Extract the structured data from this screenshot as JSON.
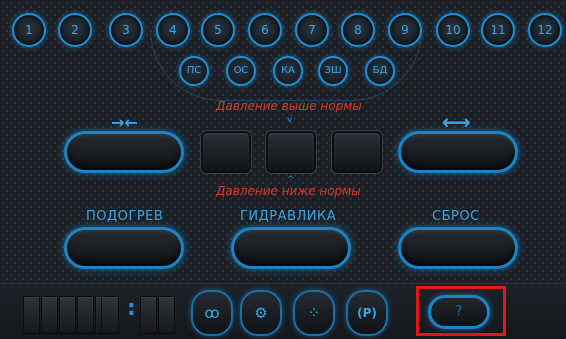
{
  "channels": [
    "1",
    "2",
    "3",
    "4",
    "5",
    "6",
    "7",
    "8",
    "9",
    "10",
    "11",
    "12"
  ],
  "modes": [
    "ПС",
    "ОС",
    "КА",
    "ЗШ",
    "БД"
  ],
  "pressure": {
    "above_norm": "Давление выше нормы",
    "below_norm": "Давление ниже нормы"
  },
  "arrows": {
    "compress": "→←",
    "expand": "⟷"
  },
  "labels": {
    "heating": "ПОДОГРЕВ",
    "hydraulics": "ГИДРАВЛИКА",
    "reset": "СБРОС"
  },
  "toolbar": {
    "colon": ":",
    "icon_coil": "ꝏ",
    "icon_gear": "⚙",
    "icon_dots": "⁘",
    "icon_parking": "(P)",
    "help": "?"
  },
  "colors": {
    "accent": "#1f8fd2",
    "warning": "#d8392c",
    "highlight": "#e01818"
  }
}
